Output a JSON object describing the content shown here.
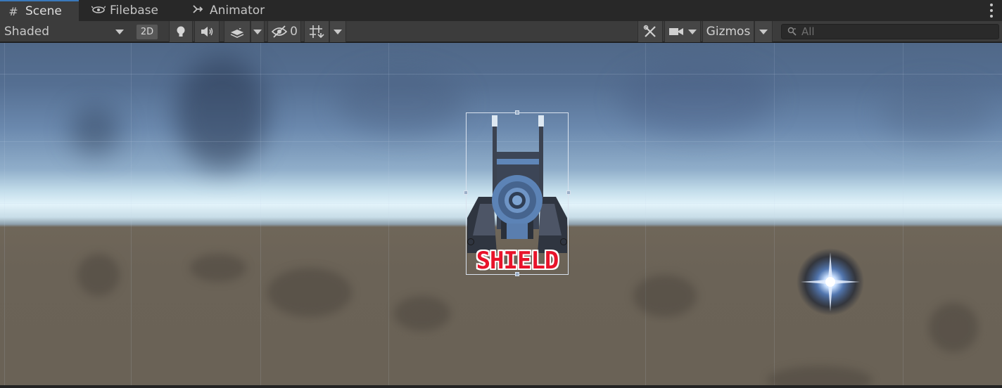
{
  "tabs": [
    {
      "label": "Scene",
      "icon": "grid-icon",
      "active": true
    },
    {
      "label": "Filebase",
      "icon": "filebase-icon",
      "active": false
    },
    {
      "label": "Animator",
      "icon": "animator-icon",
      "active": false
    }
  ],
  "toolbar": {
    "draw_mode": "Shaded",
    "btn_2d": "2D",
    "hidden_count": "0",
    "gizmos_label": "Gizmos",
    "search_placeholder": "All"
  },
  "scene": {
    "object_label": "SHIELD",
    "label_color": "#e8132a",
    "sky_color": "#6a88ad",
    "ground_color": "#6b6357",
    "accent_color": "#3a79bb"
  }
}
